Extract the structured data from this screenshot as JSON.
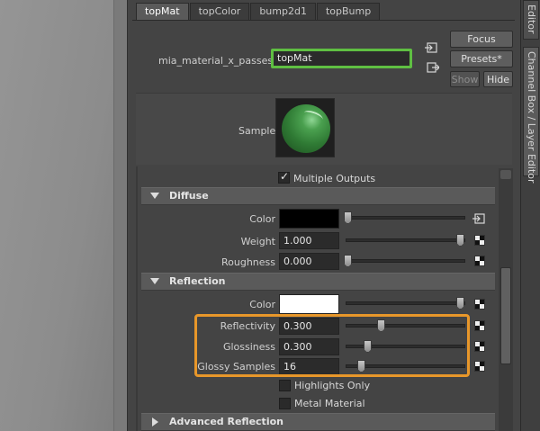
{
  "tabs": [
    {
      "label": "topMat",
      "active": true
    },
    {
      "label": "topColor"
    },
    {
      "label": "bump2d1"
    },
    {
      "label": "topBump"
    }
  ],
  "node": {
    "type_label": "mia_material_x_passes:",
    "name": "topMat"
  },
  "buttons": {
    "focus": "Focus",
    "presets": "Presets*",
    "show": "Show",
    "hide": "Hide"
  },
  "sample": {
    "label": "Sample"
  },
  "multiple_outputs": {
    "label": "Multiple Outputs",
    "checked": true
  },
  "sections": {
    "diffuse": {
      "title": "Diffuse",
      "attrs": [
        {
          "label": "Color",
          "value": "",
          "color": "#000000"
        },
        {
          "label": "Weight",
          "value": "1.000",
          "level": 1.0
        },
        {
          "label": "Roughness",
          "value": "0.000",
          "level": 0.0
        }
      ]
    },
    "reflection": {
      "title": "Reflection",
      "attrs": [
        {
          "label": "Color",
          "value": "",
          "color": "#ffffff"
        },
        {
          "label": "Reflectivity",
          "value": "0.300",
          "level": 0.3
        },
        {
          "label": "Glossiness",
          "value": "0.300",
          "level": 0.2
        },
        {
          "label": "Glossy Samples",
          "value": "16",
          "level": 0.16
        }
      ],
      "options": [
        {
          "label": "Highlights Only",
          "checked": false
        },
        {
          "label": "Metal Material",
          "checked": false
        }
      ]
    },
    "advanced_reflection": {
      "title": "Advanced Reflection"
    }
  },
  "right_tabs": [
    {
      "label": "Editor"
    },
    {
      "label": "Channel Box / Layer Editor"
    }
  ],
  "colors": {
    "focus_outline": "#5fbf42",
    "highlight_outline": "#e8972a",
    "sample_sphere": "#3f8f45"
  }
}
